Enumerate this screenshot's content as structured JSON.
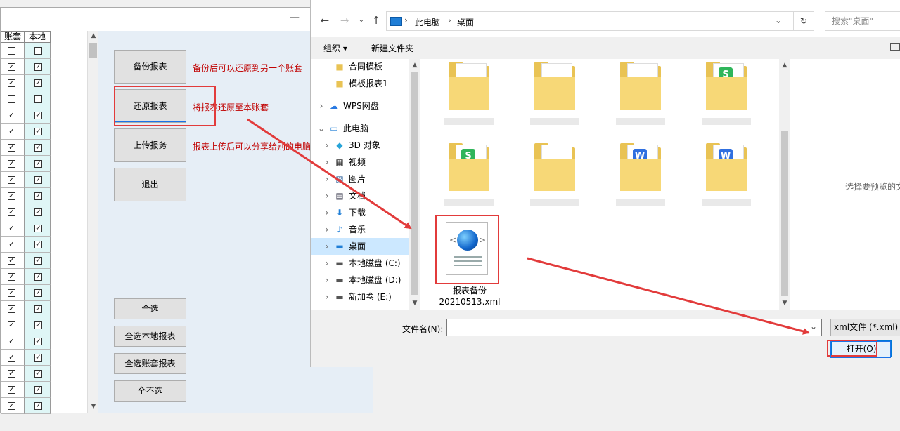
{
  "app": {
    "minimize_glyph": "—",
    "grid": {
      "col_header_account": "账套",
      "col_header_local": "本地",
      "rows": [
        {
          "account": false,
          "local": false
        },
        {
          "account": true,
          "local": true
        },
        {
          "account": true,
          "local": true
        },
        {
          "account": false,
          "local": false
        },
        {
          "account": true,
          "local": true
        },
        {
          "account": true,
          "local": true
        },
        {
          "account": true,
          "local": true
        },
        {
          "account": true,
          "local": true
        },
        {
          "account": true,
          "local": true
        },
        {
          "account": true,
          "local": true
        },
        {
          "account": true,
          "local": true
        },
        {
          "account": true,
          "local": true
        },
        {
          "account": true,
          "local": true
        },
        {
          "account": true,
          "local": true
        },
        {
          "account": true,
          "local": true
        },
        {
          "account": true,
          "local": true
        },
        {
          "account": true,
          "local": true
        },
        {
          "account": true,
          "local": true
        },
        {
          "account": true,
          "local": true
        },
        {
          "account": true,
          "local": true
        },
        {
          "account": true,
          "local": true
        },
        {
          "account": true,
          "local": true
        },
        {
          "account": true,
          "local": true
        }
      ]
    },
    "buttons": {
      "backup": "备份报表",
      "restore": "还原报表",
      "upload": "上传报务",
      "exit": "退出",
      "select_all": "全选",
      "select_all_local": "全选本地报表",
      "select_all_account": "全选账套报表",
      "select_none": "全不选"
    },
    "notes": {
      "backup": "备份后可以还原到另一个账套",
      "restore": "将报表还原至本账套",
      "upload": "报表上传后可以分享给别的电脑"
    }
  },
  "dialog": {
    "breadcrumb": [
      "此电脑",
      "桌面"
    ],
    "search_placeholder": "搜索\"桌面\"",
    "toolbar": {
      "organize": "组织 ▾",
      "new_folder": "新建文件夹"
    },
    "nav_items": [
      {
        "label": "合同模板",
        "icon": "folder-icon",
        "indent": 2,
        "expand": ""
      },
      {
        "label": "模板报表1",
        "icon": "folder-icon",
        "indent": 2,
        "expand": ""
      },
      {
        "label": "WPS网盘",
        "icon": "cloud-icon",
        "indent": 0,
        "expand": "›"
      },
      {
        "label": "此电脑",
        "icon": "pc-icon",
        "indent": 0,
        "expand": "⌄"
      },
      {
        "label": "3D 对象",
        "icon": "cube-icon",
        "indent": 1,
        "expand": "›"
      },
      {
        "label": "视频",
        "icon": "video-icon",
        "indent": 1,
        "expand": "›"
      },
      {
        "label": "图片",
        "icon": "picture-icon",
        "indent": 1,
        "expand": "›"
      },
      {
        "label": "文档",
        "icon": "document-icon",
        "indent": 1,
        "expand": "›"
      },
      {
        "label": "下载",
        "icon": "download-icon",
        "indent": 1,
        "expand": "›"
      },
      {
        "label": "音乐",
        "icon": "music-icon",
        "indent": 1,
        "expand": "›"
      },
      {
        "label": "桌面",
        "icon": "desktop-icon",
        "indent": 1,
        "expand": "›",
        "selected": true
      },
      {
        "label": "本地磁盘 (C:)",
        "icon": "drive-icon",
        "indent": 1,
        "expand": "›"
      },
      {
        "label": "本地磁盘 (D:)",
        "icon": "drive-icon",
        "indent": 1,
        "expand": "›"
      },
      {
        "label": "新加卷 (E:)",
        "icon": "drive-icon",
        "indent": 1,
        "expand": "›"
      }
    ],
    "files": [
      {
        "kind": "folder-icon",
        "badge": ""
      },
      {
        "kind": "folder-icon",
        "badge": ""
      },
      {
        "kind": "folder-icon",
        "badge": ""
      },
      {
        "kind": "wps-sheet-folder-icon",
        "badge": "S"
      },
      {
        "kind": "wps-sheet-folder-icon",
        "badge": "S"
      },
      {
        "kind": "folder-icon",
        "badge": ""
      },
      {
        "kind": "wps-doc-folder-icon",
        "badge": "W"
      },
      {
        "kind": "wps-doc-folder-icon",
        "badge": "W"
      }
    ],
    "selected_file": {
      "name_line1": "报表备份",
      "name_line2": "20210513.xml"
    },
    "preview_text": "选择要预览的文",
    "filename_label": "文件名(N):",
    "filename_value": "",
    "filetype": "xml文件 (*.xml)",
    "open_button": "打开(O)"
  },
  "colors": {
    "annotation_red": "#e23b3b",
    "focus_blue": "#1a73e8",
    "note_red": "#c00000"
  }
}
